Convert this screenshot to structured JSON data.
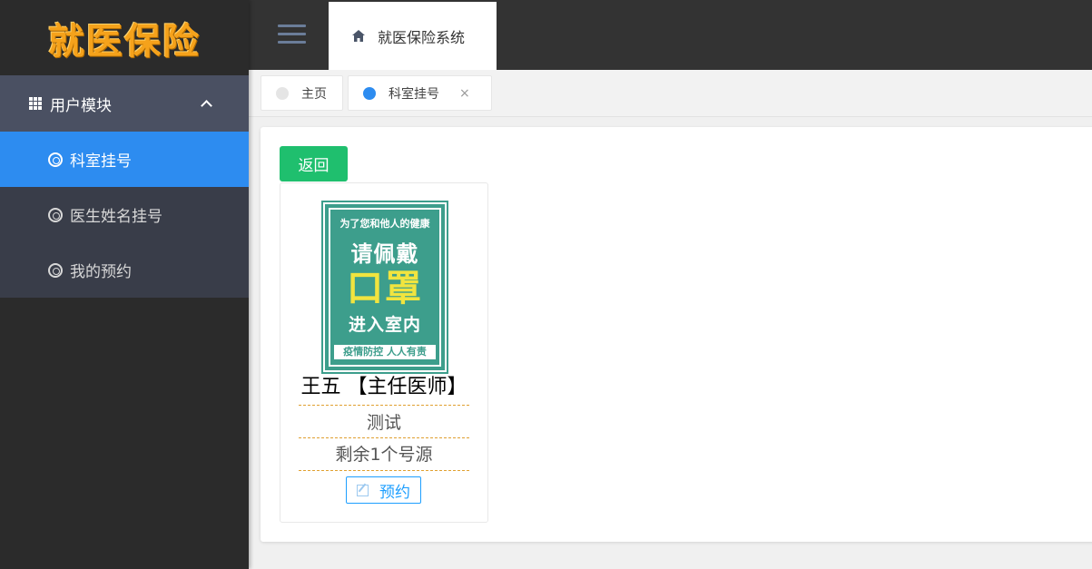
{
  "logo": {
    "text": "就医保险"
  },
  "sidebar": {
    "group_label": "用户模块",
    "items": [
      {
        "label": "科室挂号",
        "active": true
      },
      {
        "label": "医生姓名挂号",
        "active": false
      },
      {
        "label": "我的预约",
        "active": false
      }
    ]
  },
  "header": {
    "tab_label": "就医保险系统"
  },
  "tabs": [
    {
      "label": "主页"
    },
    {
      "label": "科室挂号",
      "close": "×"
    }
  ],
  "content": {
    "back_label": "返回",
    "doctor": {
      "name": "王五 【主任医师】",
      "dept": "测试",
      "remaining": "剩余1个号源",
      "book_label": "预约",
      "poster": {
        "line1": "为了您和他人的健康",
        "line2": "请佩戴",
        "line3": "口罩",
        "line4": "进入室内",
        "line5": "疫情防控 人人有责"
      }
    }
  },
  "colors": {
    "accent": "#2d8cf0",
    "success": "#1fbf6e",
    "logo": "#f5a21b",
    "poster_bg": "#3d9e8c",
    "poster_highlight": "#f1e43f"
  }
}
